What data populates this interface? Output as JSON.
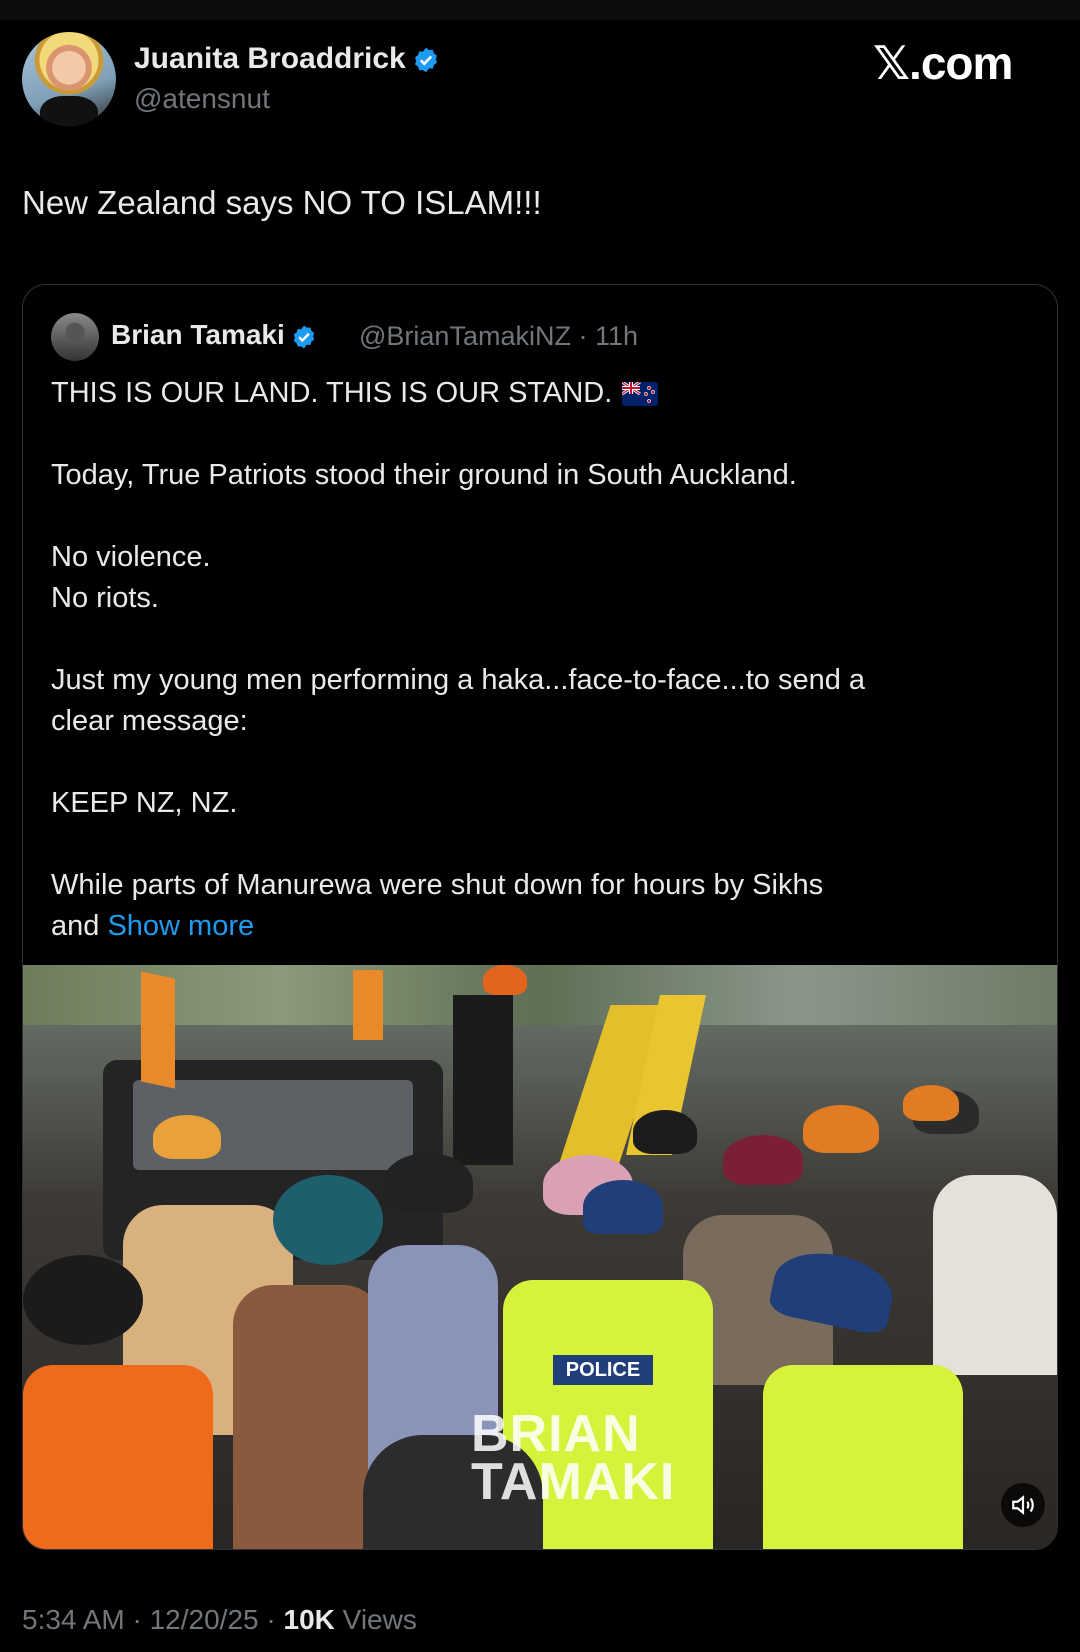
{
  "author": {
    "name": "Juanita Broaddrick",
    "handle": "@atensnut",
    "verified": true
  },
  "brand": "𝕏.com",
  "tweet": {
    "text": "New Zealand says NO TO ISLAM!!!"
  },
  "quoted": {
    "name": "Brian Tamaki",
    "handle_time": "@BrianTamakiNZ · 11h",
    "verified": true,
    "lines": [
      "THIS IS OUR LAND. THIS IS OUR STAND.",
      "Today, True Patriots stood their ground in South Auckland.",
      "No violence.",
      "No riots.",
      "Just my young men performing a haka...face-to-face...to send a",
      "clear message:",
      "KEEP NZ, NZ.",
      "While parts of Manurewa were shut down for hours by Sikhs",
      "and"
    ],
    "show_more": "Show more",
    "flag_icon": "new-zealand-flag-icon",
    "media": {
      "watermark_line1": "BRIAN",
      "watermark_line2": "TAMAKI",
      "police_label": "POLICE",
      "mute_icon": "speaker-icon"
    }
  },
  "meta": {
    "time_date": "5:34 AM · 12/20/25 · ",
    "views_count": "10K",
    "views_label": " Views"
  },
  "colors": {
    "background": "#000000",
    "text": "#e7e9ea",
    "secondary": "#71767b",
    "link": "#1d9bf0",
    "verified": "#1d9bf0"
  }
}
